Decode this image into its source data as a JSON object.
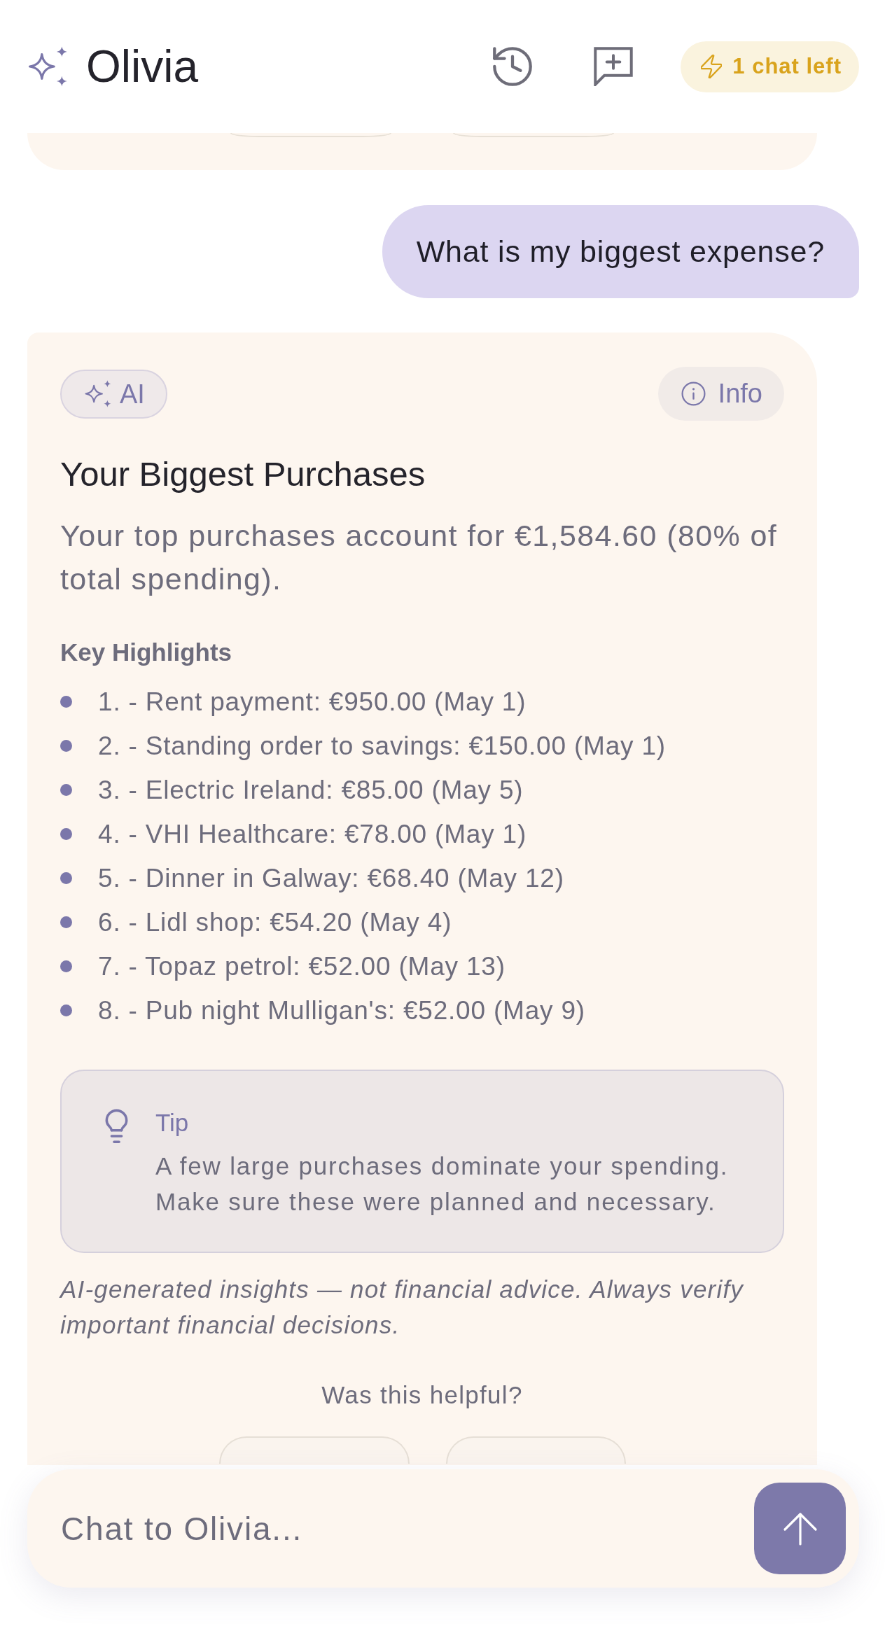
{
  "header": {
    "title": "Olivia",
    "chats_left": "1 chat left"
  },
  "messages": [
    {
      "kind": "reply_tail"
    },
    {
      "kind": "user",
      "text": "What is my biggest expense?"
    },
    {
      "kind": "assistant",
      "badge": "AI",
      "info": "Info",
      "title": "Your Biggest Purchases",
      "summary": "Your top purchases account for €1,584.60 (80% of total spending).",
      "section_title": "Key Highlights",
      "highlights": [
        "1. - Rent payment: €950.00 (May 1)",
        "2. - Standing order to savings: €150.00 (May 1)",
        "3. - Electric Ireland: €85.00 (May 5)",
        "4. - VHI Healthcare: €78.00 (May 1)",
        "5. - Dinner in Galway: €68.40 (May 12)",
        "6. - Lidl shop: €54.20 (May 4)",
        "7. - Topaz petrol: €52.00 (May 13)",
        "8. - Pub night Mulligan's: €52.00 (May 9)"
      ],
      "tip": {
        "label": "Tip",
        "text": "A few large purchases dominate your spending. Make sure these were planned and necessary."
      },
      "disclaimer": "AI-generated insights — not financial advice. Always verify important financial decisions.",
      "feedback_prompt": "Was this helpful?"
    }
  ],
  "composer": {
    "placeholder": "Chat to Olivia..."
  }
}
